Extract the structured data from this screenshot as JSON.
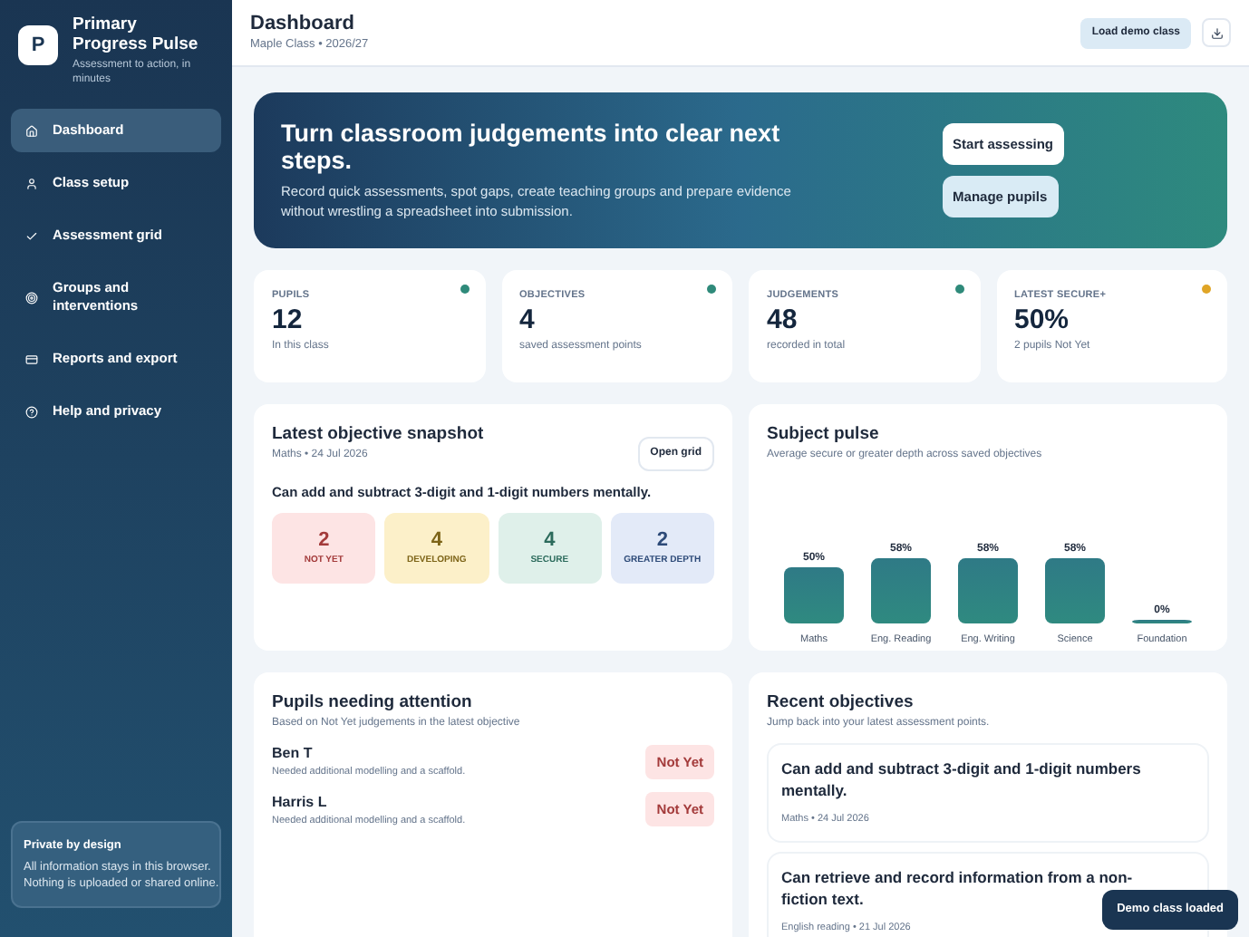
{
  "app": {
    "name": "Primary Progress Pulse",
    "tagline": "Assessment to action, in minutes",
    "logo_letter": "P"
  },
  "sidebar": {
    "items": [
      {
        "label": "Dashboard",
        "selected": true
      },
      {
        "label": "Class setup",
        "selected": false
      },
      {
        "label": "Assessment grid",
        "selected": false
      },
      {
        "label": "Groups and interventions",
        "selected": false
      },
      {
        "label": "Reports and export",
        "selected": false
      },
      {
        "label": "Help and privacy",
        "selected": false
      }
    ],
    "privacy": {
      "title": "Private by design",
      "text": "All information stays in this browser. Nothing is uploaded or shared online."
    }
  },
  "header": {
    "title": "Dashboard",
    "subtitle": "Maple Class • 2026/27",
    "button": "Load demo class"
  },
  "hero": {
    "title": "Turn classroom judgements into clear next steps.",
    "text": "Record quick assessments, spot gaps, create teaching groups and prepare evidence without wrestling a spreadsheet into submission.",
    "buttons": [
      {
        "label": "Start assessing",
        "kind": "primary"
      },
      {
        "label": "Manage pupils",
        "kind": "secondary"
      }
    ]
  },
  "stats": [
    {
      "label": "PUPILS",
      "value": "12",
      "note": "In this class",
      "color": "#2f8a7a"
    },
    {
      "label": "OBJECTIVES",
      "value": "4",
      "note": "saved assessment points",
      "color": "#2f8a7a"
    },
    {
      "label": "JUDGEMENTS",
      "value": "48",
      "note": "recorded in total",
      "color": "#2f8a7a"
    },
    {
      "label": "LATEST SECURE+",
      "value": "50%",
      "note": "2 pupils Not Yet",
      "color": "#e0a526"
    }
  ],
  "snapshot": {
    "title": "Latest objective snapshot",
    "meta": "Maths • 24 Jul 2026",
    "button": "Open grid",
    "objective": "Can add and subtract 3-digit and 1-digit numbers mentally.",
    "tiles": [
      {
        "value": "2",
        "label": "NOT YET",
        "kind": "not_yet"
      },
      {
        "value": "4",
        "label": "DEVELOPING",
        "kind": "developing"
      },
      {
        "value": "4",
        "label": "SECURE",
        "kind": "secure"
      },
      {
        "value": "2",
        "label": "GREATER DEPTH",
        "kind": "greater_depth"
      }
    ]
  },
  "subject_pulse": {
    "title": "Subject pulse",
    "subtitle": "Average secure or greater depth across saved objectives",
    "chart_data": {
      "type": "bar",
      "categories": [
        "Maths",
        "Eng. Reading",
        "Eng. Writing",
        "Science",
        "Foundation"
      ],
      "series": [
        {
          "color": "#2f7a86",
          "values": [
            50,
            58,
            58,
            58,
            0
          ],
          "value_labels": [
            "50%",
            "58%",
            "58%",
            "58%",
            "0%"
          ]
        }
      ],
      "data_labels": true
    }
  },
  "attention": {
    "title": "Pupils needing attention",
    "subtitle": "Based on Not Yet judgements in the latest objective",
    "pupils": [
      {
        "name": "Ben T",
        "note": "Needed additional modelling and a scaffold.",
        "status": "Not Yet"
      },
      {
        "name": "Harris L",
        "note": "Needed additional modelling and a scaffold.",
        "status": "Not Yet"
      }
    ]
  },
  "recent": {
    "title": "Recent objectives",
    "subtitle": "Jump back into your latest assessment points.",
    "items": [
      {
        "title": "Can add and subtract 3-digit and 1-digit numbers mentally.",
        "meta": "Maths • 24 Jul 2026"
      },
      {
        "title": "Can retrieve and record information from a non-fiction text.",
        "meta": "English reading • 21 Jul 2026"
      }
    ]
  },
  "toast": "Demo class loaded"
}
